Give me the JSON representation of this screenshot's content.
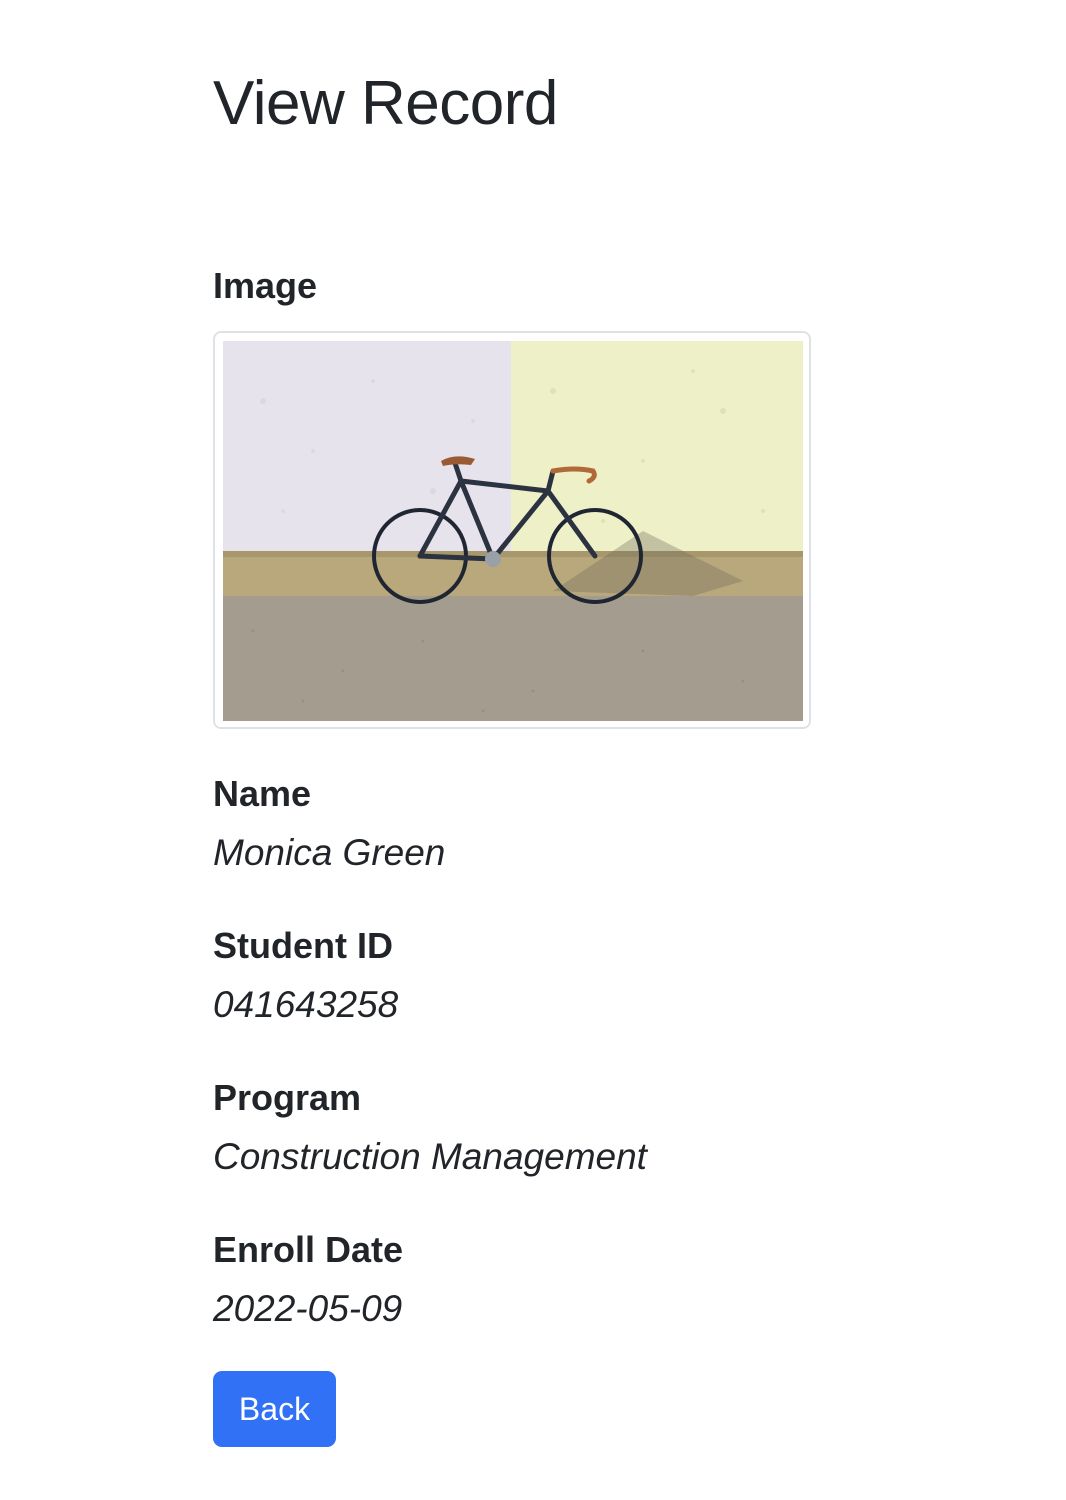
{
  "page": {
    "title": "View Record"
  },
  "record": {
    "image_label": "Image",
    "image_alt_icon": "bicycle-photo",
    "name_label": "Name",
    "name_value": "Monica Green",
    "student_id_label": "Student ID",
    "student_id_value": "041643258",
    "program_label": "Program",
    "program_value": "Construction Management",
    "enroll_date_label": "Enroll Date",
    "enroll_date_value": "2022-05-09"
  },
  "actions": {
    "back_label": "Back"
  },
  "colors": {
    "text": "#212529",
    "primary_button": "#3071f5",
    "thumbnail_border": "#dee2e6"
  }
}
